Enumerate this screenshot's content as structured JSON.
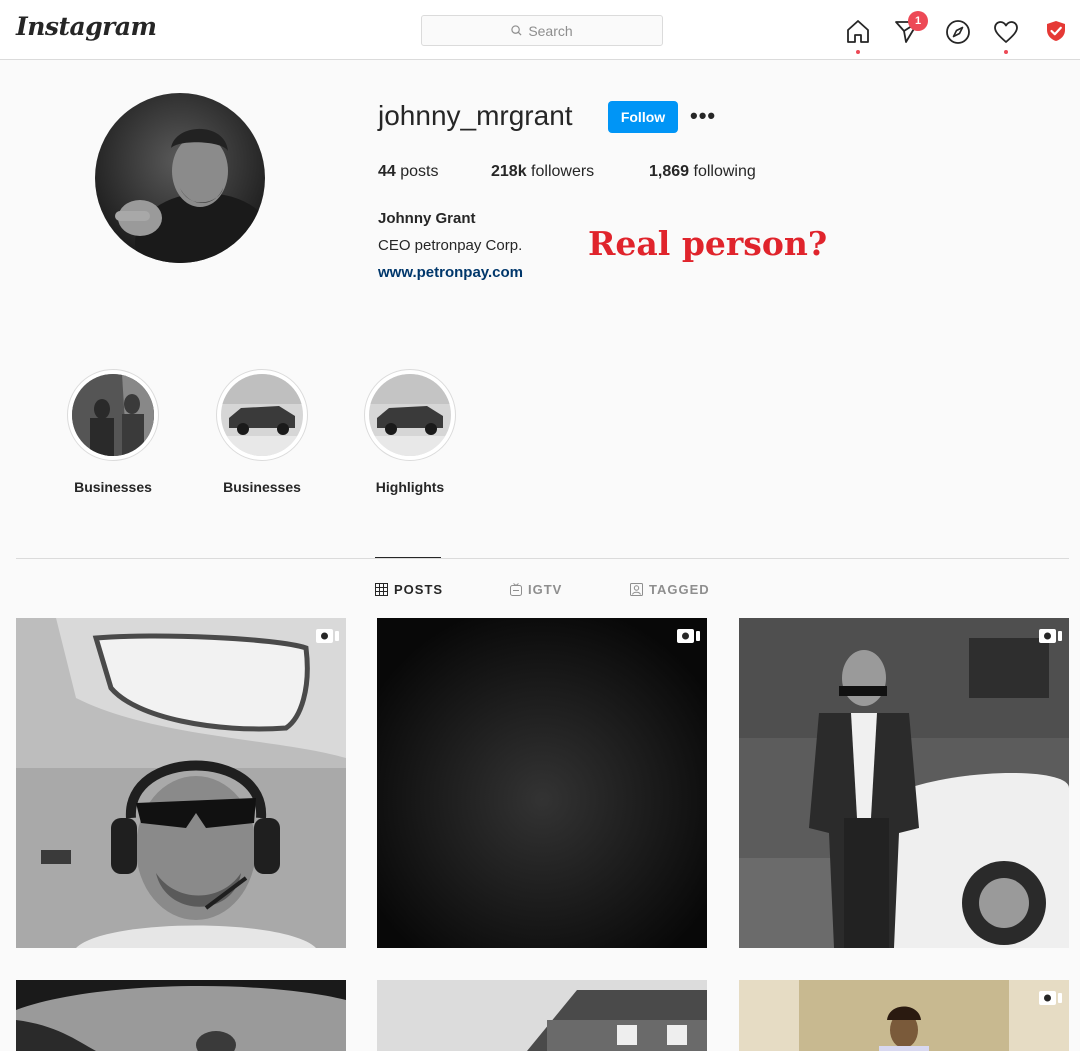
{
  "nav": {
    "logo": "Instagram",
    "search_placeholder": "Search",
    "notification_count": "1",
    "icons": [
      "home-icon",
      "direct-message-icon",
      "explore-icon",
      "activity-heart-icon",
      "shield-extension-icon"
    ],
    "colors": {
      "accent": "#0095f6",
      "badge": "#ed4956"
    }
  },
  "profile": {
    "username": "johnny_mrgrant",
    "follow_label": "Follow",
    "more_label": "•••",
    "stats": [
      {
        "count": "44",
        "label": "posts"
      },
      {
        "count": "218k",
        "label": "followers"
      },
      {
        "count": "1,869",
        "label": "following"
      }
    ],
    "full_name": "Johnny Grant",
    "bio": "CEO petronpay Corp.",
    "website": "www.petronpay.com"
  },
  "annotation": {
    "text": "Real person?",
    "color": "#e0242c"
  },
  "highlights": [
    {
      "label": "Businesses"
    },
    {
      "label": "Businesses"
    },
    {
      "label": "Highlights"
    }
  ],
  "tabs": [
    {
      "label": "POSTS",
      "active": true,
      "icon": "grid-icon"
    },
    {
      "label": "IGTV",
      "active": false,
      "icon": "igtv-icon"
    },
    {
      "label": "TAGGED",
      "active": false,
      "icon": "tagged-icon"
    }
  ],
  "posts": [
    {
      "type": "video",
      "subject": "man-with-headset-in-cockpit"
    },
    {
      "type": "video",
      "subject": "dark-vignette"
    },
    {
      "type": "video",
      "subject": "man-in-suit-by-car"
    },
    {
      "type": "image",
      "subject": "car-interior"
    },
    {
      "type": "image",
      "subject": "house-roof"
    },
    {
      "type": "video",
      "subject": "man-by-curtains"
    }
  ]
}
